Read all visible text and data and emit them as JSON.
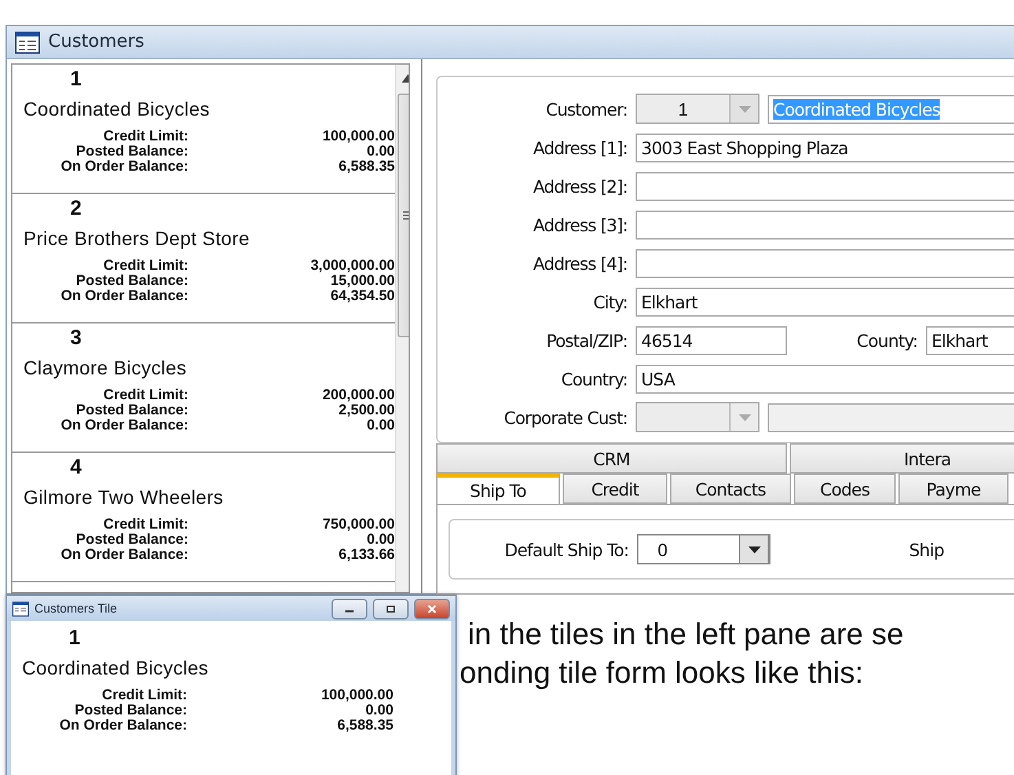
{
  "window": {
    "title": "Customers"
  },
  "tiles": [
    {
      "number": "1",
      "name": "Coordinated Bicycles",
      "fields": [
        {
          "label": "Credit Limit:",
          "value": "100,000.00"
        },
        {
          "label": "Posted Balance:",
          "value": "0.00"
        },
        {
          "label": "On Order Balance:",
          "value": "6,588.35"
        }
      ]
    },
    {
      "number": "2",
      "name": "Price Brothers Dept Store",
      "fields": [
        {
          "label": "Credit Limit:",
          "value": "3,000,000.00"
        },
        {
          "label": "Posted Balance:",
          "value": "15,000.00"
        },
        {
          "label": "On Order Balance:",
          "value": "64,354.50"
        }
      ]
    },
    {
      "number": "3",
      "name": "Claymore Bicycles",
      "fields": [
        {
          "label": "Credit Limit:",
          "value": "200,000.00"
        },
        {
          "label": "Posted Balance:",
          "value": "2,500.00"
        },
        {
          "label": "On Order Balance:",
          "value": "0.00"
        }
      ]
    },
    {
      "number": "4",
      "name": "Gilmore Two Wheelers",
      "fields": [
        {
          "label": "Credit Limit:",
          "value": "750,000.00"
        },
        {
          "label": "Posted Balance:",
          "value": "0.00"
        },
        {
          "label": "On Order Balance:",
          "value": "6,133.66"
        }
      ]
    }
  ],
  "form": {
    "fields": [
      {
        "kind": "customer",
        "label": "Customer:",
        "code": "1",
        "value": "Coordinated Bicycles",
        "selected": true
      },
      {
        "kind": "text",
        "label": "Address [1]:",
        "value": "3003 East Shopping Plaza"
      },
      {
        "kind": "text",
        "label": "Address [2]:"
      },
      {
        "kind": "text",
        "label": "Address [3]:"
      },
      {
        "kind": "text",
        "label": "Address [4]:"
      },
      {
        "kind": "text",
        "label": "City:",
        "value": "Elkhart"
      },
      {
        "kind": "pair",
        "label": "Postal/ZIP:",
        "value": "46514",
        "label2": "County:",
        "value2": "Elkhart"
      },
      {
        "kind": "text",
        "label": "Country:",
        "value": "USA"
      },
      {
        "kind": "lookup",
        "label": "Corporate Cust:",
        "disabled": true
      }
    ]
  },
  "tab_rows": [
    [
      {
        "label": "CRM",
        "selected": false
      },
      {
        "label": "Intera",
        "selected": false
      }
    ],
    [
      {
        "label": "Ship To",
        "selected": true
      },
      {
        "label": "Credit",
        "selected": false
      },
      {
        "label": "Contacts",
        "selected": false
      },
      {
        "label": "Codes",
        "selected": false
      },
      {
        "label": "Payme",
        "selected": false
      }
    ]
  ],
  "ship_to": {
    "label": "Default Ship To:",
    "value": "0",
    "label2": "Ship"
  },
  "tile_window": {
    "title": "Customers Tile",
    "tile": {
      "number": "1",
      "name": "Coordinated Bicycles",
      "fields": [
        {
          "label": "Credit Limit:",
          "value": "100,000.00"
        },
        {
          "label": "Posted Balance:",
          "value": "0.00"
        },
        {
          "label": "On Order Balance:",
          "value": "6,588.35"
        }
      ]
    }
  },
  "paragraph": {
    "lines": [
      "in the tiles in the left pane are se",
      "onding tile form looks like this:"
    ]
  }
}
